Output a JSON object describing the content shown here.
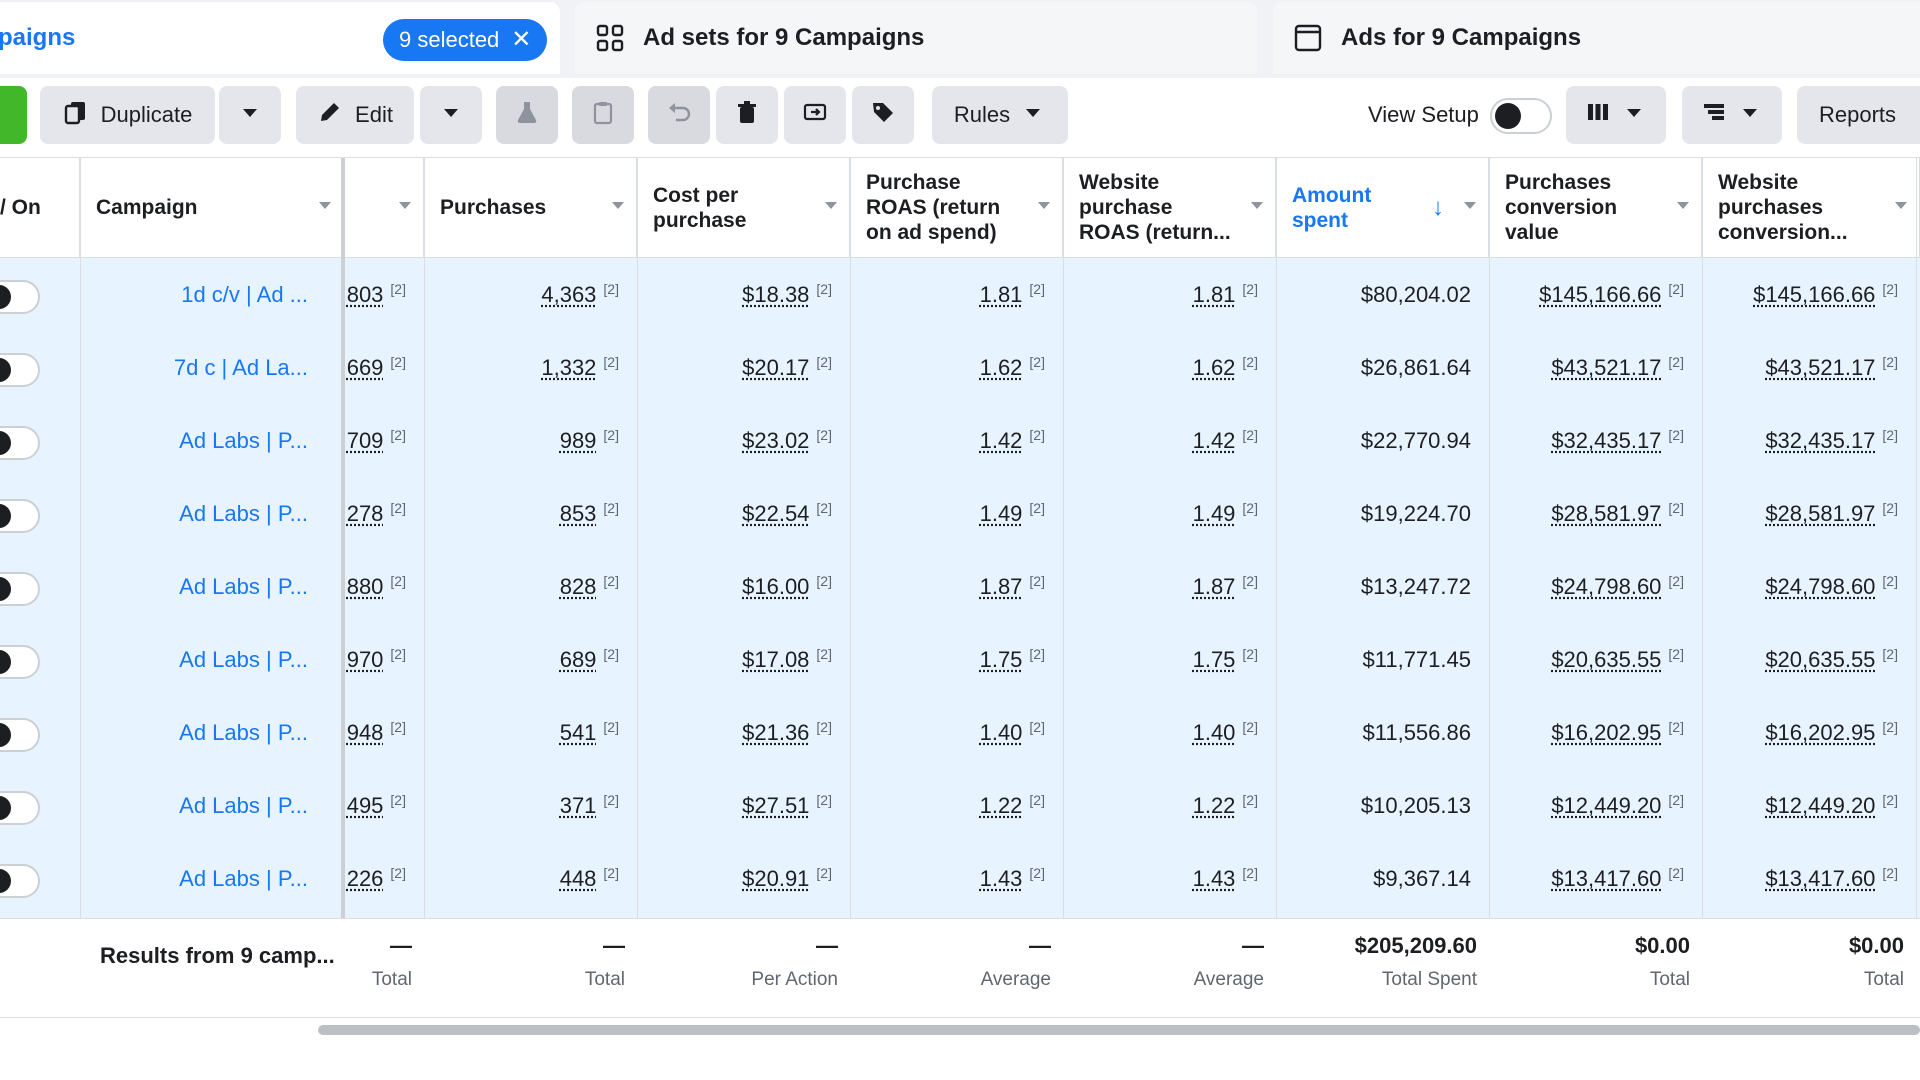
{
  "tabs": {
    "campaigns_label": "paigns",
    "selected_label": "9 selected",
    "adsets_label": "Ad sets for 9 Campaigns",
    "ads_label": "Ads for 9 Campaigns"
  },
  "toolbar": {
    "duplicate_label": "Duplicate",
    "edit_label": "Edit",
    "rules_label": "Rules",
    "view_setup_label": "View Setup",
    "reports_label": "Reports"
  },
  "columns": {
    "onoff": "/ On",
    "campaign": "Campaign",
    "purchases": "Purchases",
    "cost_per_purchase": "Cost per purchase",
    "purchase_roas": "Purchase ROAS (return on ad spend)",
    "website_roas": "Website purchase ROAS (return...",
    "amount_spent": "Amount spent",
    "conversion_value": "Purchases conversion value",
    "website_conversion": "Website purchases conversion..."
  },
  "rows": [
    {
      "campaign": "1d c/v | Ad ...",
      "c1": "803",
      "purchases": "4,363",
      "cpp": "$18.38",
      "roas": "1.81",
      "wroas": "1.81",
      "spent": "$80,204.02",
      "value": "$145,166.66",
      "wvalue": "$145,166.66"
    },
    {
      "campaign": "7d c | Ad La...",
      "c1": "669",
      "purchases": "1,332",
      "cpp": "$20.17",
      "roas": "1.62",
      "wroas": "1.62",
      "spent": "$26,861.64",
      "value": "$43,521.17",
      "wvalue": "$43,521.17"
    },
    {
      "campaign": "Ad Labs | P...",
      "c1": "709",
      "purchases": "989",
      "cpp": "$23.02",
      "roas": "1.42",
      "wroas": "1.42",
      "spent": "$22,770.94",
      "value": "$32,435.17",
      "wvalue": "$32,435.17"
    },
    {
      "campaign": "Ad Labs | P...",
      "c1": "278",
      "purchases": "853",
      "cpp": "$22.54",
      "roas": "1.49",
      "wroas": "1.49",
      "spent": "$19,224.70",
      "value": "$28,581.97",
      "wvalue": "$28,581.97"
    },
    {
      "campaign": "Ad Labs | P...",
      "c1": "880",
      "purchases": "828",
      "cpp": "$16.00",
      "roas": "1.87",
      "wroas": "1.87",
      "spent": "$13,247.72",
      "value": "$24,798.60",
      "wvalue": "$24,798.60"
    },
    {
      "campaign": "Ad Labs | P...",
      "c1": "970",
      "purchases": "689",
      "cpp": "$17.08",
      "roas": "1.75",
      "wroas": "1.75",
      "spent": "$11,771.45",
      "value": "$20,635.55",
      "wvalue": "$20,635.55"
    },
    {
      "campaign": "Ad Labs | P...",
      "c1": "948",
      "purchases": "541",
      "cpp": "$21.36",
      "roas": "1.40",
      "wroas": "1.40",
      "spent": "$11,556.86",
      "value": "$16,202.95",
      "wvalue": "$16,202.95"
    },
    {
      "campaign": "Ad Labs | P...",
      "c1": "495",
      "purchases": "371",
      "cpp": "$27.51",
      "roas": "1.22",
      "wroas": "1.22",
      "spent": "$10,205.13",
      "value": "$12,449.20",
      "wvalue": "$12,449.20"
    },
    {
      "campaign": "Ad Labs | P...",
      "c1": "226",
      "purchases": "448",
      "cpp": "$20.91",
      "roas": "1.43",
      "wroas": "1.43",
      "spent": "$9,367.14",
      "value": "$13,417.60",
      "wvalue": "$13,417.60"
    }
  ],
  "footnote_mark": "[2]",
  "footer": {
    "results_label": "Results from 9 camp...",
    "dash": "—",
    "c1_label": "Total",
    "purchases_label": "Total",
    "cpp_label": "Per Action",
    "roas_label": "Average",
    "wroas_label": "Average",
    "spent_value": "$205,209.60",
    "spent_label": "Total Spent",
    "value_value": "$0.00",
    "value_label": "Total",
    "wvalue_value": "$0.00",
    "wvalue_label": "Total"
  }
}
